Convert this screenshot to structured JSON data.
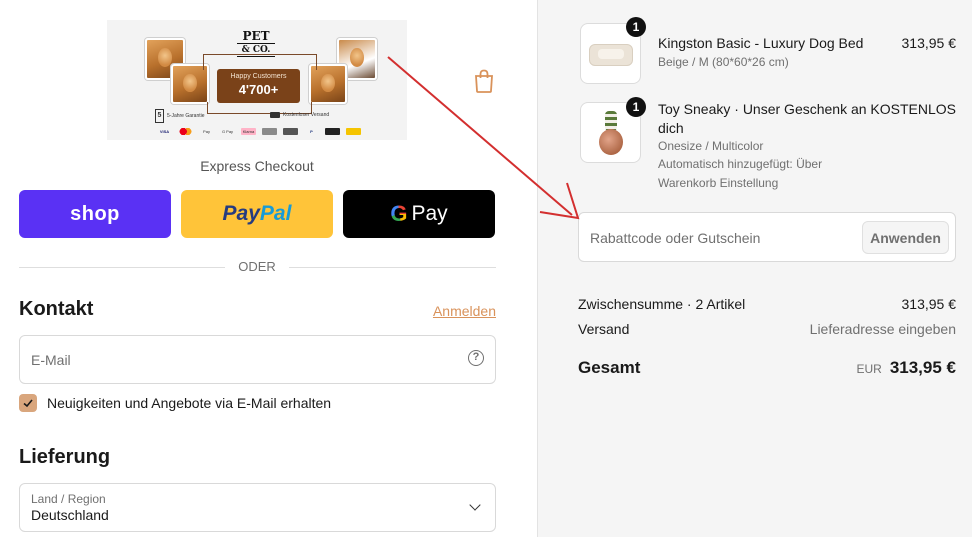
{
  "banner": {
    "logo_line1": "PET",
    "logo_line2": "& CO.",
    "happy_label": "Happy Customers",
    "happy_count": "4'700+",
    "guarantee_number": "5",
    "guarantee_text": "5-Jahre Garantie",
    "shipping_text": "Kostenloser Versand",
    "payment_logos": [
      "VISA",
      "MC",
      "Pay",
      "G Pay",
      "Klarna",
      "",
      "",
      "PayPal",
      "",
      ""
    ]
  },
  "express": {
    "title": "Express Checkout",
    "shop_label": "shop",
    "paypal_part1": "Pay",
    "paypal_part2": "Pal",
    "gpay_g": "G",
    "gpay_label": "Pay"
  },
  "divider_label": "ODER",
  "contact": {
    "title": "Kontakt",
    "login_link": "Anmelden",
    "email_placeholder": "E-Mail",
    "help_glyph": "?",
    "newsletter_label": "Neuigkeiten und Angebote via E-Mail erhalten"
  },
  "delivery": {
    "title": "Lieferung",
    "country_label": "Land / Region",
    "country_value": "Deutschland"
  },
  "order": {
    "items": [
      {
        "qty": "1",
        "name": "Kingston Basic - Luxury Dog Bed",
        "variant": "Beige / M (80*60*26 cm)",
        "price": "313,95 €"
      },
      {
        "qty": "1",
        "name_line1": "Toy Sneaky · Unser Geschenk an",
        "name_line2": "dich",
        "variant": "Onesize / Multicolor",
        "note_line1": "Automatisch hinzugefügt: Über",
        "note_line2": "Warenkorb Einstellung",
        "price": "KOSTENLOS"
      }
    ],
    "discount_placeholder": "Rabattcode oder Gutschein",
    "apply_label": "Anwenden",
    "subtotal_label": "Zwischensumme · 2 Artikel",
    "subtotal_value": "313,95 €",
    "shipping_label": "Versand",
    "shipping_value": "Lieferadresse eingeben",
    "total_label": "Gesamt",
    "total_currency": "EUR",
    "total_value": "313,95 €"
  },
  "colors": {
    "shop_purple": "#5a31f4",
    "paypal_yellow": "#ffc439",
    "accent": "#d9925a",
    "annotation_arrow": "#d32f2f"
  }
}
